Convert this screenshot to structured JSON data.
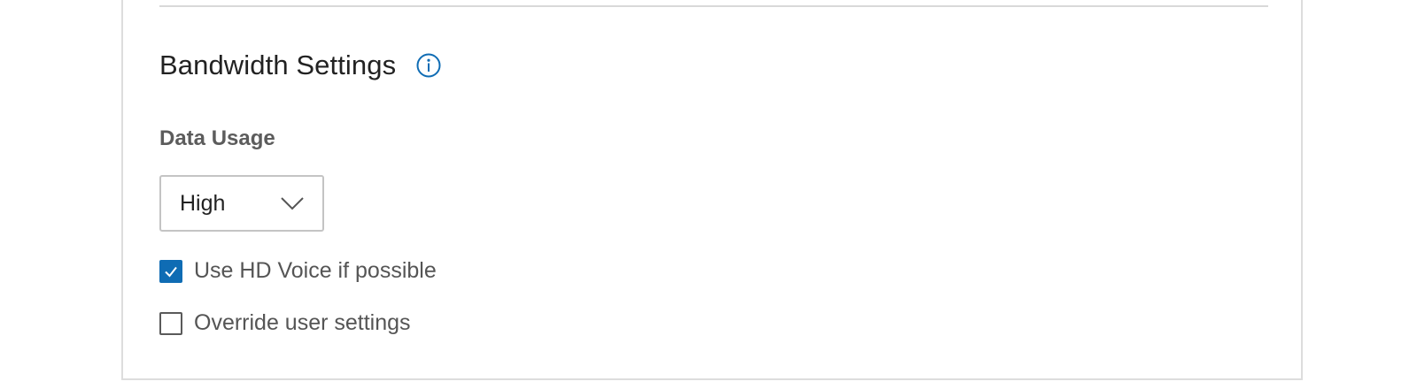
{
  "section": {
    "title": "Bandwidth Settings",
    "info_icon": "info-circle-icon"
  },
  "data_usage": {
    "label": "Data Usage",
    "selected": "High",
    "dropdown_icon": "chevron-down-icon"
  },
  "options": [
    {
      "label": "Use HD Voice if possible",
      "checked": true
    },
    {
      "label": "Override user settings",
      "checked": false
    }
  ],
  "colors": {
    "accent": "#0f6cb4",
    "title": "#222222",
    "muted_text": "#5c5c5c",
    "border": "#c4c4c4"
  }
}
